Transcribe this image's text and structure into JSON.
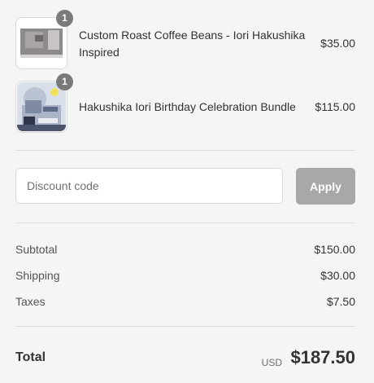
{
  "line_items": [
    {
      "quantity": "1",
      "name": "Custom Roast Coffee Beans - Iori Hakushika Inspired",
      "price": "$35.00"
    },
    {
      "quantity": "1",
      "name": "Hakushika Iori Birthday Celebration Bundle",
      "price": "$115.00"
    }
  ],
  "discount": {
    "placeholder": "Discount code",
    "apply_label": "Apply"
  },
  "summary": {
    "subtotal_label": "Subtotal",
    "subtotal_value": "$150.00",
    "shipping_label": "Shipping",
    "shipping_value": "$30.00",
    "taxes_label": "Taxes",
    "taxes_value": "$7.50"
  },
  "total": {
    "label": "Total",
    "currency": "USD",
    "value": "$187.50"
  }
}
